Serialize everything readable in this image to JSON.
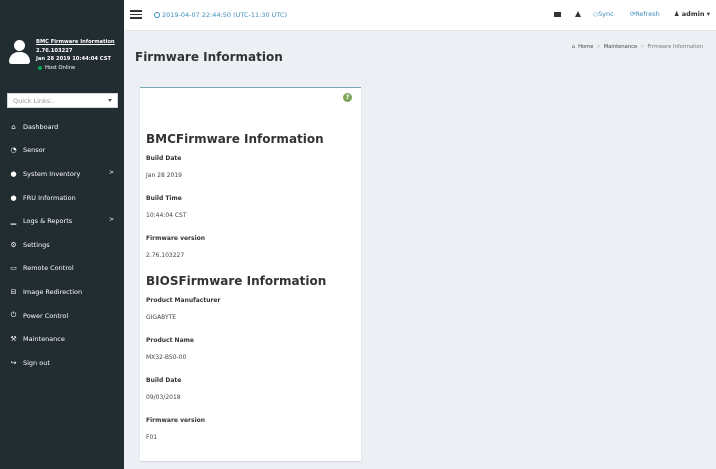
{
  "user": {
    "title": "BMC Firmware Information",
    "version": "2.76.103227",
    "build": "Jan 28 2019 10:44:04 CST",
    "status": "Host Online"
  },
  "quick_links": {
    "placeholder": "Quick Links.."
  },
  "sidebar": {
    "items": [
      {
        "label": "Dashboard",
        "icon": "dashboard-icon",
        "glyph": "⌂",
        "has_arrow": false
      },
      {
        "label": "Sensor",
        "icon": "sensor-icon",
        "glyph": "◔",
        "has_arrow": false
      },
      {
        "label": "System Inventory",
        "icon": "info-icon",
        "glyph": "●",
        "has_arrow": true
      },
      {
        "label": "FRU Information",
        "icon": "info-icon",
        "glyph": "●",
        "has_arrow": false
      },
      {
        "label": "Logs & Reports",
        "icon": "chart-icon",
        "glyph": "▁",
        "has_arrow": true
      },
      {
        "label": "Settings",
        "icon": "gear-icon",
        "glyph": "⚙",
        "has_arrow": false
      },
      {
        "label": "Remote Control",
        "icon": "monitor-icon",
        "glyph": "▭",
        "has_arrow": false
      },
      {
        "label": "Image Redirection",
        "icon": "disk-icon",
        "glyph": "⊟",
        "has_arrow": false
      },
      {
        "label": "Power Control",
        "icon": "power-icon",
        "glyph": "⏻",
        "has_arrow": false
      },
      {
        "label": "Maintenance",
        "icon": "wrench-icon",
        "glyph": "⚒",
        "has_arrow": false
      },
      {
        "label": "Sign out",
        "icon": "signout-icon",
        "glyph": "↪",
        "has_arrow": false
      }
    ],
    "arrow": ">"
  },
  "topbar": {
    "datetime": "2019-04-07 22:44:50 (UTC-11:30 UTC)",
    "sync": "Sync",
    "refresh": "Refresh",
    "admin": "admin"
  },
  "header": {
    "title": "Firmware Information"
  },
  "breadcrumb": {
    "home": "Home",
    "maintenance": "Maintenance",
    "current": "Firmware Information",
    "sep": ">"
  },
  "bmc": {
    "title": "BMCFirmware Information",
    "build_date_label": "Build Date",
    "build_date": "Jan 28 2019",
    "build_time_label": "Build Time",
    "build_time": "10:44:04 CST",
    "fw_version_label": "Firmware version",
    "fw_version": "2.76.103227"
  },
  "bios": {
    "title": "BIOSFirmware Information",
    "manufacturer_label": "Product Manufacturer",
    "manufacturer": "GIGABYTE",
    "product_name_label": "Product Name",
    "product_name": "MX32-BS0-00",
    "build_date_label": "Build Date",
    "build_date": "09/03/2018",
    "fw_version_label": "Firmware version",
    "fw_version": "F01"
  },
  "colors": {
    "sidebar_bg": "#222d32",
    "accent": "#3c8dbc",
    "online": "#00a65a",
    "help": "#7ea55a"
  }
}
